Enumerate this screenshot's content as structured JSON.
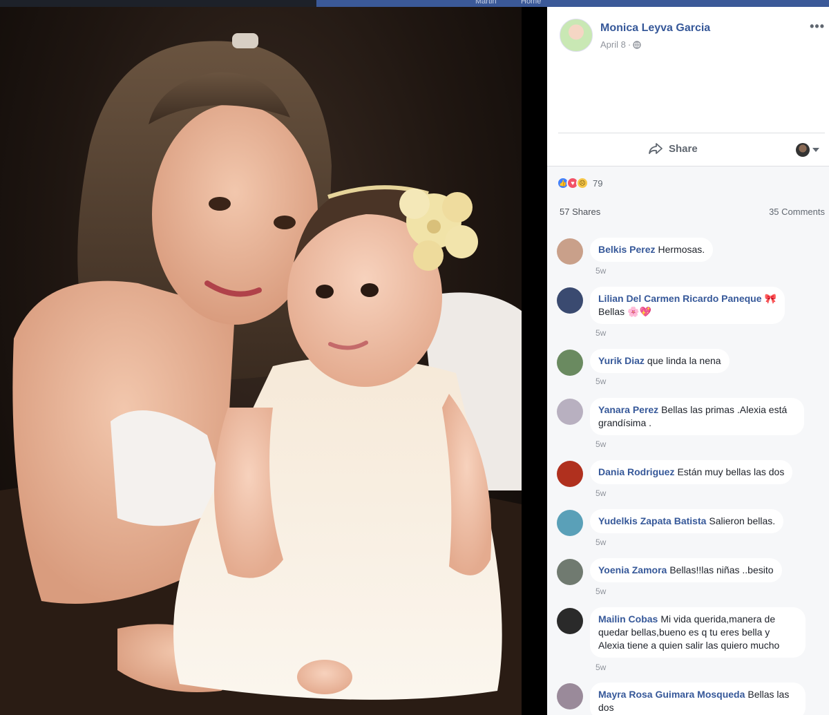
{
  "topbar": {
    "nav_left": "Martin",
    "nav_right": "Home"
  },
  "post": {
    "author": "Monica Leyva Garcia",
    "date": "April 8",
    "privacy_icon": "globe-icon",
    "more_label": "•••"
  },
  "actions": {
    "share_label": "Share"
  },
  "summary": {
    "reactions": [
      "like",
      "love",
      "sad"
    ],
    "reaction_count": "79",
    "shares_label": "57 Shares",
    "comments_label": "35 Comments"
  },
  "colors": {
    "link": "#365899",
    "panel_bg": "#f6f7f9",
    "facebook_blue": "#3b5998"
  },
  "comments": [
    {
      "name": "Belkis Perez",
      "text": "Hermosas.",
      "time": "5w",
      "avatar_color": "#c9a08a"
    },
    {
      "name": "Lilian Del Carmen Ricardo Paneque",
      "emoji_after_name": "🎀",
      "text": "Bellas 🌸💖",
      "time": "5w",
      "avatar_color": "#3a4a70"
    },
    {
      "name": "Yurik Diaz",
      "text": "que linda la nena",
      "time": "5w",
      "avatar_color": "#6a8a60"
    },
    {
      "name": "Yanara Perez",
      "text": "Bellas las primas .Alexia está grandísima .",
      "time": "5w",
      "avatar_color": "#b8b0c0"
    },
    {
      "name": "Dania Rodriguez",
      "text": "Están muy bellas las dos",
      "time": "5w",
      "avatar_color": "#b0301e"
    },
    {
      "name": "Yudelkis Zapata Batista",
      "text": "Salieron bellas.",
      "time": "5w",
      "avatar_color": "#5aa0b8"
    },
    {
      "name": "Yoenia Zamora",
      "text": "Bellas!!las niñas ..besito",
      "time": "5w",
      "avatar_color": "#707a70"
    },
    {
      "name": "Mailin Cobas",
      "text": "Mi vida querida,manera de quedar bellas,bueno es q tu eres bella y Alexia tiene a quien salir las quiero mucho",
      "time": "5w",
      "avatar_color": "#2a2a2a"
    },
    {
      "name": "Mayra Rosa Guimara Mosqueda",
      "text": "Bellas las dos",
      "time": "",
      "avatar_color": "#9a8a9a"
    }
  ]
}
